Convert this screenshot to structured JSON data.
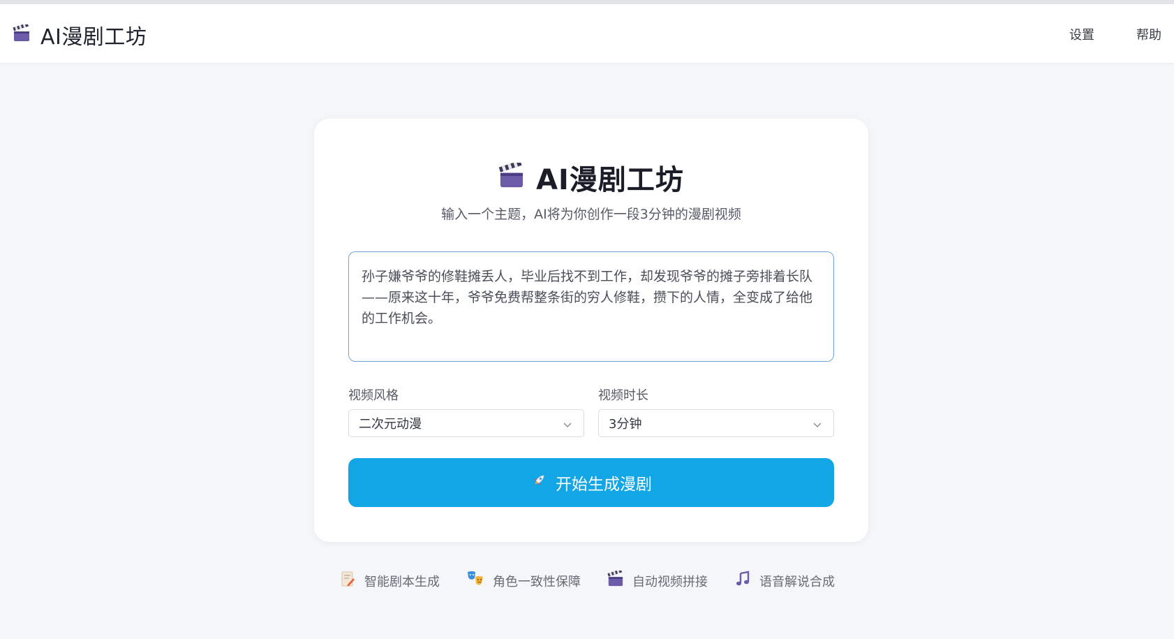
{
  "header": {
    "app_title": "AI漫剧工坊",
    "logo_icon": "clapperboard-icon",
    "nav": [
      {
        "label": "设置"
      },
      {
        "label": "帮助"
      }
    ]
  },
  "hero": {
    "icon": "clapperboard-icon",
    "title": "AI漫剧工坊",
    "subtitle": "输入一个主题，AI将为你创作一段3分钟的漫剧视频"
  },
  "form": {
    "topic_value": "孙子嫌爷爷的修鞋摊丢人，毕业后找不到工作，却发现爷爷的摊子旁排着长队——原来这十年，爷爷免费帮整条街的穷人修鞋，攒下的人情，全变成了给他的工作机会。",
    "style_label": "视频风格",
    "style_value": "二次元动漫",
    "duration_label": "视频时长",
    "duration_value": "3分钟",
    "submit_label": "开始生成漫剧",
    "submit_icon": "rocket-icon"
  },
  "features": [
    {
      "icon": "memo-icon",
      "label": "智能剧本生成"
    },
    {
      "icon": "theater-masks-icon",
      "label": "角色一致性保障"
    },
    {
      "icon": "clapperboard-icon",
      "label": "自动视频拼接"
    },
    {
      "icon": "music-note-icon",
      "label": "语音解说合成"
    }
  ],
  "colors": {
    "accent": "#12a6e6",
    "background": "#f5f6f9",
    "card": "#ffffff",
    "input_border": "#6fa2d8"
  }
}
